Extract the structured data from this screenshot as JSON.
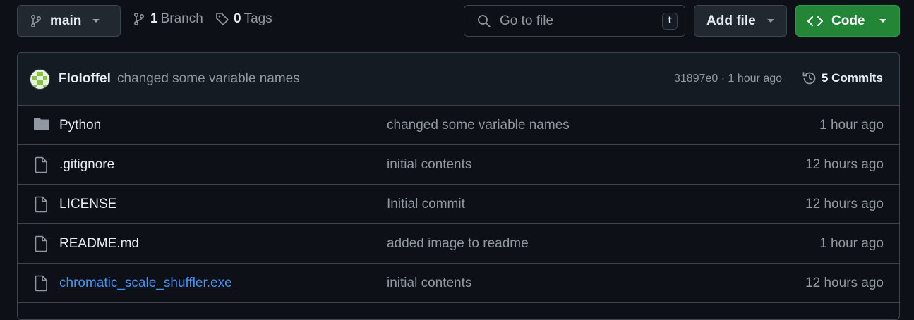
{
  "toolbar": {
    "branch_name": "main",
    "branch_count": "1",
    "branch_label": "Branch",
    "tag_count": "0",
    "tag_label": "Tags",
    "search_placeholder": "Go to file",
    "search_shortcut": "t",
    "add_file_label": "Add file",
    "code_label": "Code"
  },
  "latest_commit": {
    "author": "Floloffel",
    "message": "changed some variable names",
    "hash_time": "31897e0 · 1 hour ago",
    "commits_count": "5 Commits"
  },
  "files": [
    {
      "name": "Python",
      "type": "folder",
      "message": "changed some variable names",
      "time": "1 hour ago"
    },
    {
      "name": ".gitignore",
      "type": "file",
      "message": "initial contents",
      "time": "12 hours ago"
    },
    {
      "name": "LICENSE",
      "type": "file",
      "message": "Initial commit",
      "time": "12 hours ago"
    },
    {
      "name": "README.md",
      "type": "file",
      "message": "added image to readme",
      "time": "1 hour ago"
    },
    {
      "name": "chromatic_scale_shuffler.exe",
      "type": "file",
      "message": "initial contents",
      "time": "12 hours ago"
    }
  ],
  "icons": {
    "branch": "git-branch-icon",
    "tag": "tag-icon",
    "search": "search-icon",
    "code": "code-icon",
    "history": "history-icon",
    "folder": "folder-icon",
    "file": "file-icon"
  },
  "colors": {
    "background": "#0d1117",
    "header_background": "#151b23",
    "border": "#3d444d",
    "code_button": "#238636",
    "link": "#4493f8",
    "muted_text": "#9198a1"
  }
}
